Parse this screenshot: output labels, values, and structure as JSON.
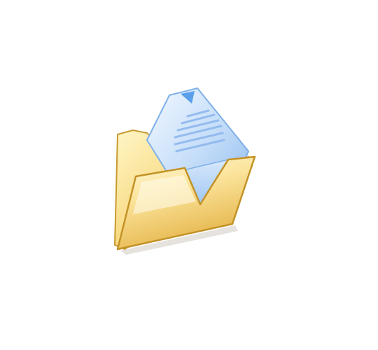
{
  "icon": {
    "name": "open-folder-document-icon",
    "colors": {
      "folder_light": "#fff3b8",
      "folder_mid": "#f7d978",
      "folder_dark": "#d9a83a",
      "folder_edge": "#b98a24",
      "doc_light": "#e8f2ff",
      "doc_mid": "#a9ccf5",
      "doc_dark": "#5f9be0",
      "doc_lines": "#8fb8ee",
      "background": "#ffffff"
    }
  }
}
